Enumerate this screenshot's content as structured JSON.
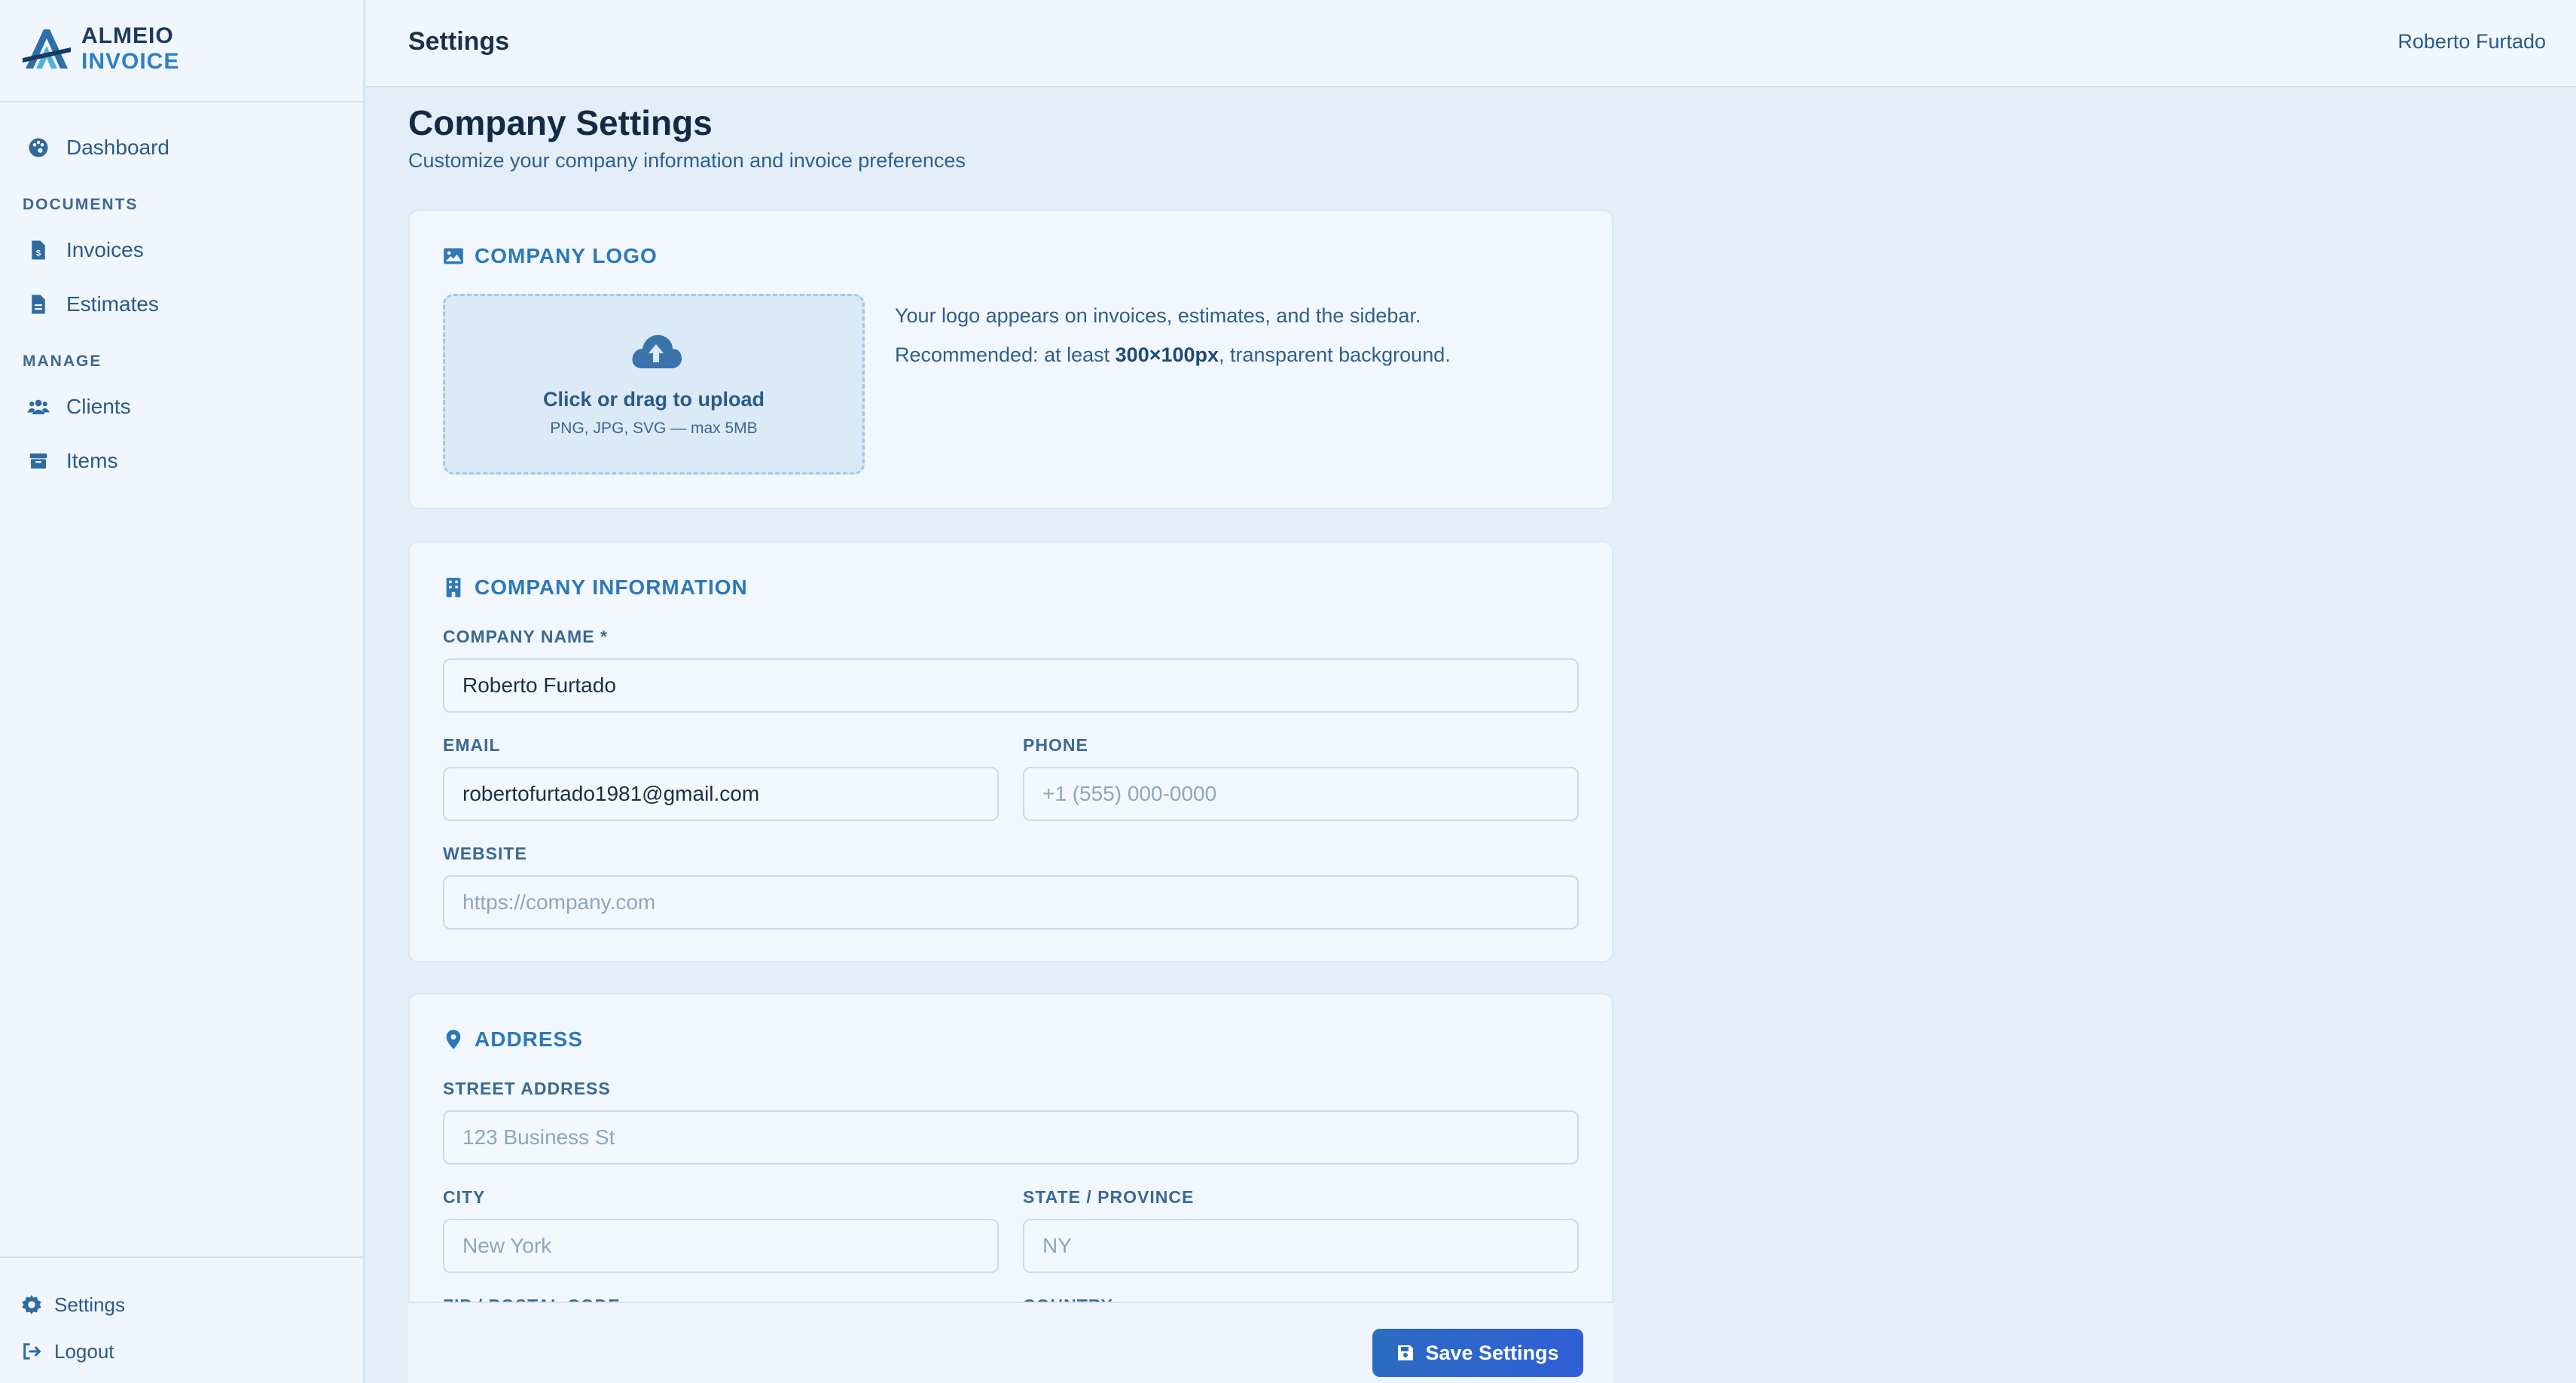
{
  "brand": {
    "line1": "ALMEIO",
    "line2": "INVOICE"
  },
  "sidebar": {
    "items": [
      {
        "label": "Dashboard",
        "icon": "palette-icon"
      },
      {
        "label": "Invoices",
        "icon": "invoice-file-icon"
      },
      {
        "label": "Estimates",
        "icon": "file-icon"
      },
      {
        "label": "Clients",
        "icon": "users-icon"
      },
      {
        "label": "Items",
        "icon": "box-icon"
      }
    ],
    "sections": {
      "documents": "DOCUMENTS",
      "manage": "MANAGE"
    },
    "footer": {
      "settings": "Settings",
      "logout": "Logout"
    }
  },
  "topbar": {
    "title": "Settings",
    "user": "Roberto Furtado"
  },
  "page": {
    "title": "Company Settings",
    "subtitle": "Customize your company information and invoice preferences"
  },
  "logo_card": {
    "heading": "COMPANY LOGO",
    "upload_title": "Click or drag to upload",
    "upload_hint": "PNG, JPG, SVG — max 5MB",
    "info_line1": "Your logo appears on invoices, estimates, and the sidebar.",
    "info_line2_prefix": "Recommended: at least ",
    "info_line2_bold": "300×100px",
    "info_line2_suffix": ", transparent background."
  },
  "company_card": {
    "heading": "COMPANY INFORMATION",
    "name_label": "COMPANY NAME *",
    "name_value": "Roberto Furtado",
    "email_label": "EMAIL",
    "email_value": "robertofurtado1981@gmail.com",
    "phone_label": "PHONE",
    "phone_placeholder": "+1 (555) 000-0000",
    "website_label": "WEBSITE",
    "website_placeholder": "https://company.com"
  },
  "address_card": {
    "heading": "ADDRESS",
    "street_label": "STREET ADDRESS",
    "street_placeholder": "123 Business St",
    "city_label": "CITY",
    "city_placeholder": "New York",
    "state_label": "STATE / PROVINCE",
    "state_placeholder": "NY",
    "zip_label": "ZIP / POSTAL CODE",
    "country_label": "COUNTRY"
  },
  "actions": {
    "save": "Save Settings"
  },
  "colors": {
    "accent": "#2d78b8",
    "primary_button": "#2c6cc1",
    "background": "#e3eef9"
  }
}
